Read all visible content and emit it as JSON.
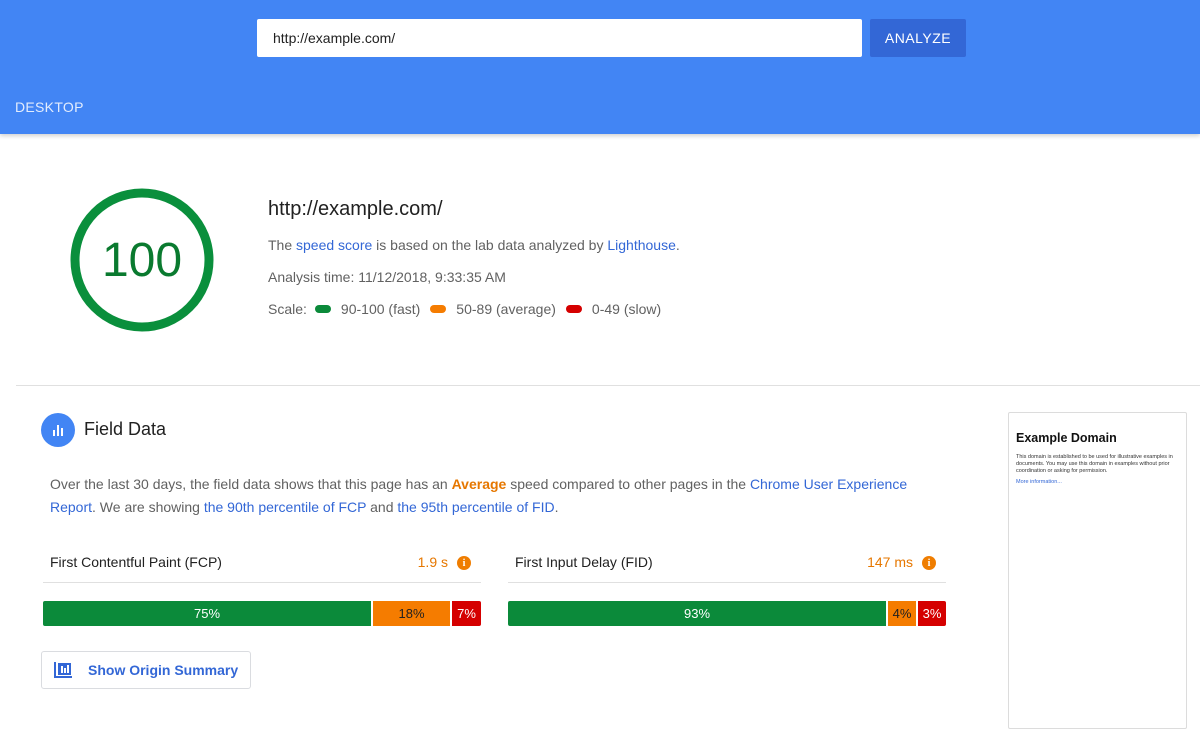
{
  "header": {
    "url_value": "http://example.com/",
    "analyze_label": "ANALYZE",
    "tab_label": "DESKTOP",
    "bg_color": "#4285f4"
  },
  "score": {
    "value": "100",
    "url": "http://example.com/",
    "desc_prefix": "The ",
    "desc_link1": "speed score",
    "desc_mid": " is based on the lab data analyzed by ",
    "desc_link2": "Lighthouse",
    "desc_suffix": ".",
    "analysis_time": "Analysis time: 11/12/2018, 9:33:35 AM",
    "scale_label": "Scale:",
    "scale": [
      {
        "label": "90-100 (fast)",
        "color": "#0b8a3a"
      },
      {
        "label": "50-89 (average)",
        "color": "#f57c00"
      },
      {
        "label": "0-49 (slow)",
        "color": "#d50000"
      }
    ]
  },
  "field_data": {
    "title": "Field Data",
    "icon": "bar-chart-icon",
    "para_1": "Over the last 30 days, the field data shows that this page has an ",
    "para_avg": "Average",
    "para_2": " speed compared to other pages in the ",
    "para_link1": "Chrome User Experience Report",
    "para_3": ". We are showing ",
    "para_link2": "the 90th percentile of FCP",
    "para_4": " and ",
    "para_link3": "the 95th percentile of FID",
    "para_5": ".",
    "metrics": [
      {
        "label": "First Contentful Paint (FCP)",
        "value": "1.9 s",
        "distribution": [
          {
            "label": "75%",
            "fraction": 0.75,
            "kind": "fast"
          },
          {
            "label": "18%",
            "fraction": 0.18,
            "kind": "avg"
          },
          {
            "label": "7%",
            "fraction": 0.07,
            "kind": "slow"
          }
        ]
      },
      {
        "label": "First Input Delay (FID)",
        "value": "147 ms",
        "distribution": [
          {
            "label": "93%",
            "fraction": 0.93,
            "kind": "fast"
          },
          {
            "label": "4%",
            "fraction": 0.04,
            "kind": "avg"
          },
          {
            "label": "3%",
            "fraction": 0.03,
            "kind": "slow"
          }
        ]
      }
    ],
    "origin_button_label": "Show Origin Summary"
  },
  "thumbnail": {
    "title": "Example Domain",
    "body": "This domain is established to be used for illustrative examples in documents. You may use this domain in examples without prior coordination or asking for permission.",
    "link": "More information..."
  }
}
